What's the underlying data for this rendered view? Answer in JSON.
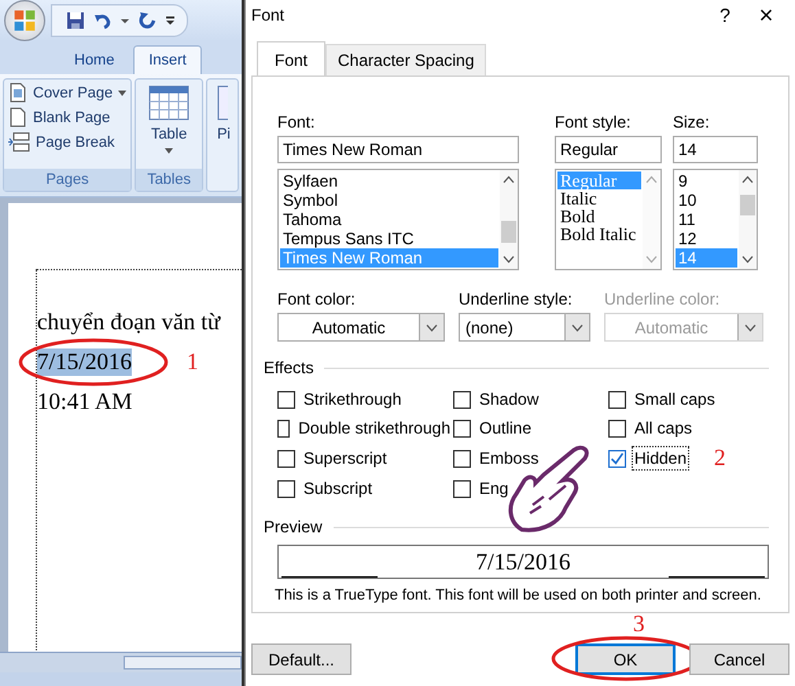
{
  "word": {
    "tabs": [
      {
        "label": "Home",
        "selected": false
      },
      {
        "label": "Insert",
        "selected": true
      }
    ],
    "ribbon_groups": [
      {
        "label": "Pages",
        "items": [
          {
            "kind": "cover",
            "label": "Cover Page",
            "dropdown": true
          },
          {
            "kind": "blank",
            "label": "Blank Page",
            "dropdown": false
          },
          {
            "kind": "break",
            "label": "Page Break",
            "dropdown": false
          }
        ]
      },
      {
        "label": "Tables",
        "items": [
          {
            "kind": "table",
            "label": "Table",
            "dropdown": true
          }
        ]
      }
    ],
    "cut_group_text": "Pi",
    "document_lines": [
      {
        "text": "chuyển đoạn văn từ",
        "selected": false
      },
      {
        "text": "7/15/2016",
        "selected": true
      },
      {
        "text": "10:41 AM",
        "selected": false
      }
    ]
  },
  "dialog": {
    "title": "Font",
    "help": "?",
    "close": "×",
    "tabs": [
      {
        "label": "Font",
        "selected": true
      },
      {
        "label": "Character Spacing",
        "selected": false
      }
    ],
    "font": {
      "label": "Font:",
      "value": "Times New Roman",
      "options": [
        {
          "label": "Sylfaen",
          "selected": false
        },
        {
          "label": "Symbol",
          "selected": false
        },
        {
          "label": "Tahoma",
          "selected": false
        },
        {
          "label": "Tempus Sans ITC",
          "selected": false
        },
        {
          "label": "Times New Roman",
          "selected": true
        }
      ]
    },
    "style": {
      "label": "Font style:",
      "value": "Regular",
      "options": [
        {
          "label": "Regular",
          "selected": true
        },
        {
          "label": "Italic",
          "selected": false
        },
        {
          "label": "Bold",
          "selected": false
        },
        {
          "label": "Bold Italic",
          "selected": false
        }
      ]
    },
    "size": {
      "label": "Size:",
      "value": "14",
      "options": [
        {
          "label": "9",
          "selected": false
        },
        {
          "label": "10",
          "selected": false
        },
        {
          "label": "11",
          "selected": false
        },
        {
          "label": "12",
          "selected": false
        },
        {
          "label": "14",
          "selected": true
        }
      ]
    },
    "dropdowns": [
      {
        "label": "Font color:",
        "value": "Automatic",
        "disabled": false
      },
      {
        "label": "Underline style:",
        "value": "(none)",
        "disabled": false
      },
      {
        "label": "Underline color:",
        "value": "Automatic",
        "disabled": true
      }
    ],
    "effects_heading": "Effects",
    "effects": [
      {
        "label": "Strikethrough",
        "checked": false
      },
      {
        "label": "Shadow",
        "checked": false
      },
      {
        "label": "Small caps",
        "checked": false
      },
      {
        "label": "Double strikethrough",
        "checked": false
      },
      {
        "label": "Outline",
        "checked": false
      },
      {
        "label": "All caps",
        "checked": false
      },
      {
        "label": "Superscript",
        "checked": false
      },
      {
        "label": "Emboss",
        "checked": false
      },
      {
        "label": "Hidden",
        "checked": true
      },
      {
        "label": "Subscript",
        "checked": false
      },
      {
        "label": "Eng",
        "checked": false
      }
    ],
    "preview_heading": "Preview",
    "preview_text": "7/15/2016",
    "note": "This is a TrueType font. This font will be used on both printer and screen.",
    "buttons": [
      {
        "label": "Default...",
        "default": false
      },
      {
        "label": "OK",
        "default": true
      },
      {
        "label": "Cancel",
        "default": false
      }
    ]
  },
  "annotations": [
    {
      "number": "1"
    },
    {
      "number": "2"
    },
    {
      "number": "3"
    }
  ]
}
